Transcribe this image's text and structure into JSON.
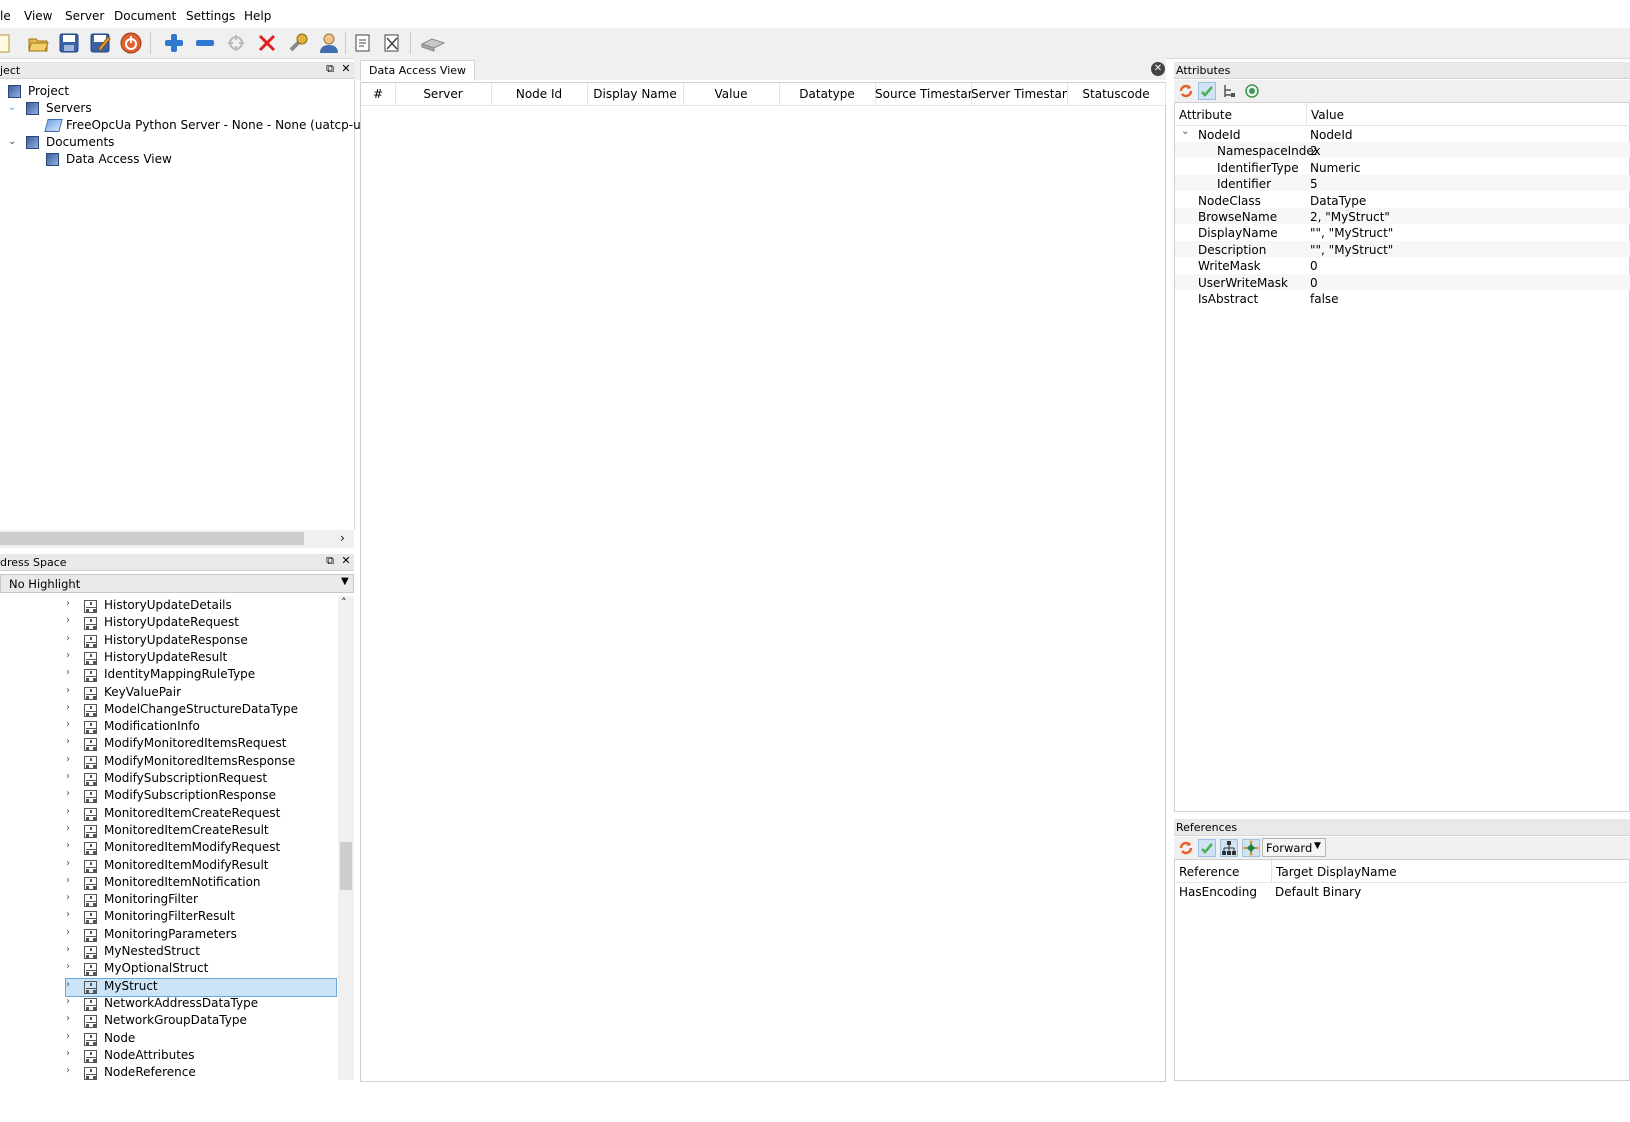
{
  "menu": [
    "le",
    "View",
    "Server",
    "Document",
    "Settings",
    "Help"
  ],
  "toolbar_icons": [
    "new-icon",
    "open-icon",
    "save-icon",
    "save-as-icon",
    "power-icon",
    "add-icon",
    "remove-icon",
    "connect-icon",
    "disconnect-icon",
    "settings-icon",
    "user-icon",
    "document-icon",
    "close-document-icon",
    "monitor-icon"
  ],
  "project_panel": {
    "title": "ject",
    "items": [
      {
        "label": "Project",
        "level": 0,
        "expander": ""
      },
      {
        "label": "Servers",
        "level": 1,
        "expander": "v"
      },
      {
        "label": "FreeOpcUa Python Server - None - None (uatcp-uasc-ua",
        "level": 2,
        "expander": ""
      },
      {
        "label": "Documents",
        "level": 1,
        "expander": "v"
      },
      {
        "label": "Data Access View",
        "level": 2,
        "expander": ""
      }
    ]
  },
  "address_space": {
    "title": "dress Space",
    "highlight_select": "No Highlight",
    "selected": "MyStruct",
    "items": [
      "HistoryUpdateDetails",
      "HistoryUpdateRequest",
      "HistoryUpdateResponse",
      "HistoryUpdateResult",
      "IdentityMappingRuleType",
      "KeyValuePair",
      "ModelChangeStructureDataType",
      "ModificationInfo",
      "ModifyMonitoredItemsRequest",
      "ModifyMonitoredItemsResponse",
      "ModifySubscriptionRequest",
      "ModifySubscriptionResponse",
      "MonitoredItemCreateRequest",
      "MonitoredItemCreateResult",
      "MonitoredItemModifyRequest",
      "MonitoredItemModifyResult",
      "MonitoredItemNotification",
      "MonitoringFilter",
      "MonitoringFilterResult",
      "MonitoringParameters",
      "MyNestedStruct",
      "MyOptionalStruct",
      "MyStruct",
      "NetworkAddressDataType",
      "NetworkGroupDataType",
      "Node",
      "NodeAttributes",
      "NodeReference"
    ]
  },
  "data_access_view": {
    "tab": "Data Access View",
    "columns": [
      "#",
      "Server",
      "Node Id",
      "Display Name",
      "Value",
      "Datatype",
      "Source Timestamp",
      "Server Timestamp",
      "Statuscode"
    ]
  },
  "attributes": {
    "title": "Attributes",
    "columns": [
      "Attribute",
      "Value"
    ],
    "rows": [
      {
        "name": "NodeId",
        "value": "NodeId",
        "indent": 1,
        "expander": "v"
      },
      {
        "name": "NamespaceIndex",
        "value": "2",
        "indent": 2,
        "expander": ""
      },
      {
        "name": "IdentifierType",
        "value": "Numeric",
        "indent": 2,
        "expander": ""
      },
      {
        "name": "Identifier",
        "value": "5",
        "indent": 2,
        "expander": ""
      },
      {
        "name": "NodeClass",
        "value": "DataType",
        "indent": 1,
        "expander": ""
      },
      {
        "name": "BrowseName",
        "value": "2, \"MyStruct\"",
        "indent": 1,
        "expander": ""
      },
      {
        "name": "DisplayName",
        "value": "\"\", \"MyStruct\"",
        "indent": 1,
        "expander": ""
      },
      {
        "name": "Description",
        "value": "\"\", \"MyStruct\"",
        "indent": 1,
        "expander": ""
      },
      {
        "name": "WriteMask",
        "value": "0",
        "indent": 1,
        "expander": ""
      },
      {
        "name": "UserWriteMask",
        "value": "0",
        "indent": 1,
        "expander": ""
      },
      {
        "name": "IsAbstract",
        "value": "false",
        "indent": 1,
        "expander": ""
      }
    ]
  },
  "references": {
    "title": "References",
    "direction": "Forward",
    "columns": [
      "Reference",
      "Target DisplayName"
    ],
    "rows": [
      {
        "reference": "HasEncoding",
        "target": "Default Binary"
      }
    ]
  }
}
